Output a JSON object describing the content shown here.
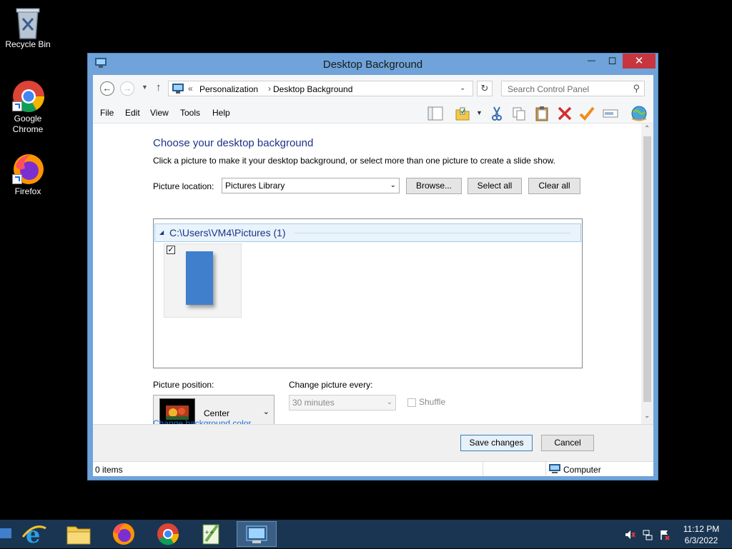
{
  "desktop": {
    "icons": [
      {
        "label": "Recycle Bin",
        "icon": "recycle-bin-icon"
      },
      {
        "label": "Google Chrome",
        "icon": "chrome-icon"
      },
      {
        "label": "Firefox",
        "icon": "firefox-icon"
      }
    ]
  },
  "window": {
    "title": "Desktop Background",
    "controls": {
      "minimize": "—",
      "maximize": "☐",
      "close": "✕"
    }
  },
  "address_bar": {
    "prefix": "«",
    "breadcrumbs": [
      "Personalization",
      "Desktop Background"
    ],
    "separator": "›",
    "search_placeholder": "Search Control Panel"
  },
  "menu": [
    "File",
    "Edit",
    "View",
    "Tools",
    "Help"
  ],
  "page": {
    "heading": "Choose your desktop background",
    "subtext": "Click a picture to make it your desktop background, or select more than one picture to create a slide show.",
    "picture_location_label": "Picture location:",
    "picture_location_value": "Pictures Library",
    "browse_button": "Browse...",
    "select_all_button": "Select all",
    "clear_all_button": "Clear all",
    "group_header": "C:\\Users\\VM4\\Pictures (1)",
    "thumbnail_checked": true,
    "picture_position_label": "Picture position:",
    "picture_position_value": "Center",
    "change_picture_label": "Change picture every:",
    "change_picture_value": "30 minutes",
    "shuffle_label": "Shuffle",
    "change_bg_color_link": "Change background color"
  },
  "footer": {
    "save_button": "Save changes",
    "cancel_button": "Cancel"
  },
  "status": {
    "items": "0 items",
    "location": "Computer"
  },
  "taskbar": {
    "apps": [
      "internet-explorer-icon",
      "file-explorer-icon",
      "firefox-icon",
      "chrome-icon",
      "notepad-plus-icon",
      "control-panel-icon"
    ],
    "time": "11:12 PM",
    "date": "6/3/2022"
  },
  "colors": {
    "accent": "#1e3287",
    "link": "#1e6fd9",
    "titlebar": "#6fa3d9",
    "close": "#c7363f",
    "taskbar": "#1a3552"
  }
}
